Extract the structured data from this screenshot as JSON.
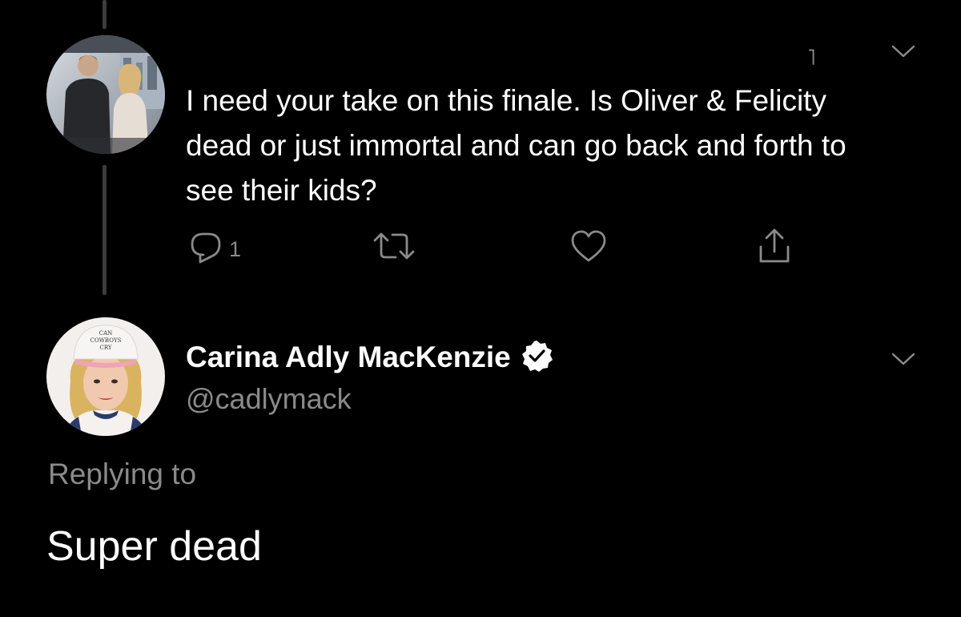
{
  "colors": {
    "background": "#000000",
    "primary_text": "#ffffff",
    "secondary_text": "#8a8a8a",
    "thread_line": "#3d3d3d"
  },
  "parent_tweet": {
    "avatar_icon": "profile-photo-couple",
    "menu_icon": "chevron-down-icon",
    "text": "I need your take on this finale. Is Oliver & Felicity dead or just immortal and can go back and forth to see their kids?",
    "actions": {
      "reply_icon": "reply-icon",
      "reply_count": "1",
      "retweet_icon": "retweet-icon",
      "like_icon": "heart-icon",
      "share_icon": "share-icon"
    }
  },
  "reply_tweet": {
    "avatar_icon": "profile-photo-woman-cap",
    "author_name": "Carina Adly MacKenzie",
    "verified_icon": "verified-badge-icon",
    "handle": "@cadlymack",
    "menu_icon": "chevron-down-icon",
    "replying_to": "Replying to",
    "text": "Super dead"
  }
}
